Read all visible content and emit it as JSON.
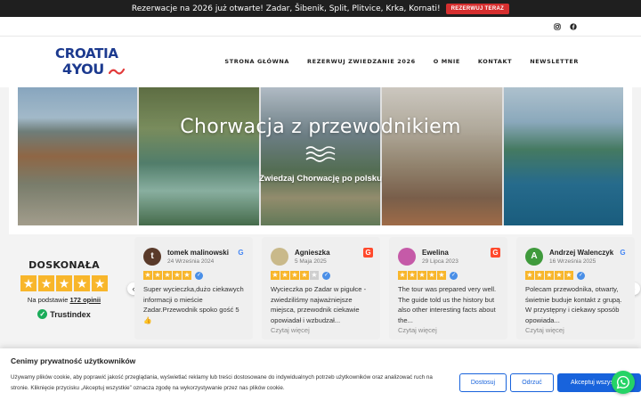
{
  "announcement": {
    "text": "Rezerwacje na 2026 już otwarte! Zadar, Šibenik, Split, Plitvice, Krka, Kornati!",
    "button_label": "REZERWUJ TERAZ"
  },
  "social": {
    "icons": [
      "instagram-icon",
      "facebook-icon"
    ]
  },
  "logo": {
    "line1": "CROATIA",
    "line2": "4YOU"
  },
  "nav": {
    "items": [
      {
        "label": "STRONA GŁÓWNA"
      },
      {
        "label": "REZERWUJ ZWIEDZANIE 2026"
      },
      {
        "label": "O MNIE"
      },
      {
        "label": "KONTAKT"
      },
      {
        "label": "NEWSLETTER"
      }
    ]
  },
  "hero": {
    "title": "Chorwacja z przewodnikiem",
    "subtitle": "Zwiedzaj Chorwację po polsku"
  },
  "rating": {
    "label": "DOSKONAŁA",
    "stars": 5,
    "based_prefix": "Na podstawie",
    "count": "172 opinii",
    "brand": "Trustindex"
  },
  "reviews": [
    {
      "initial": "t",
      "avatar_color": "#5a3a2a",
      "name": "tomek malinowski",
      "date": "24 Września 2024",
      "source": "google",
      "rating": 5,
      "text": "Super wycieczka,dużo ciekawych informacji o mieście Zadar.Przewodnik spoko gość 5👍",
      "more": ""
    },
    {
      "initial": "",
      "avatar_color": "#c9b98a",
      "name": "Agnieszka",
      "date": "5 Maja 2025",
      "source": "g2",
      "rating": 4,
      "text": "Wycieczka po Zadar w pigułce - zwiedziliśmy najważniejsze miejsca, przewodnik ciekawie opowiadał i wzbudzał...",
      "more": "Czytaj więcej"
    },
    {
      "initial": "",
      "avatar_color": "#c55aa8",
      "name": "Ewelina",
      "date": "29 Lipca 2023",
      "source": "g2",
      "rating": 5,
      "text": "The tour was prepared very well. The guide told us the history but also other interesting facts about the...",
      "more": "Czytaj więcej"
    },
    {
      "initial": "A",
      "avatar_color": "#3f9a3c",
      "name": "Andrzej Walenczyk",
      "date": "16 Września 2025",
      "source": "google",
      "rating": 5,
      "text": "Polecam przewodnika, otwarty, świetnie buduje kontakt z grupą. W przystępny i ciekawy sposób opowiada...",
      "more": "Czytaj więcej"
    }
  ],
  "cookie": {
    "title": "Cenimy prywatność użytkowników",
    "text": "Używamy plików cookie, aby poprawić jakość przeglądania, wyświetlać reklamy lub treści dostosowane do indywidualnych potrzeb użytkowników oraz analizować ruch na stronie. Kliknięcie przycisku „Akceptuj wszystkie” oznacza zgodę na wykorzystywanie przez nas plików cookie.",
    "btn_customize": "Dostosuj",
    "btn_reject": "Odrzuć",
    "btn_accept": "Akceptuj wszystkie"
  },
  "colors": {
    "accent_red": "#d62f2f",
    "brand_blue": "#1c3a8f",
    "cookie_blue": "#1863dc",
    "star": "#f8b62b",
    "whatsapp": "#25d366"
  }
}
